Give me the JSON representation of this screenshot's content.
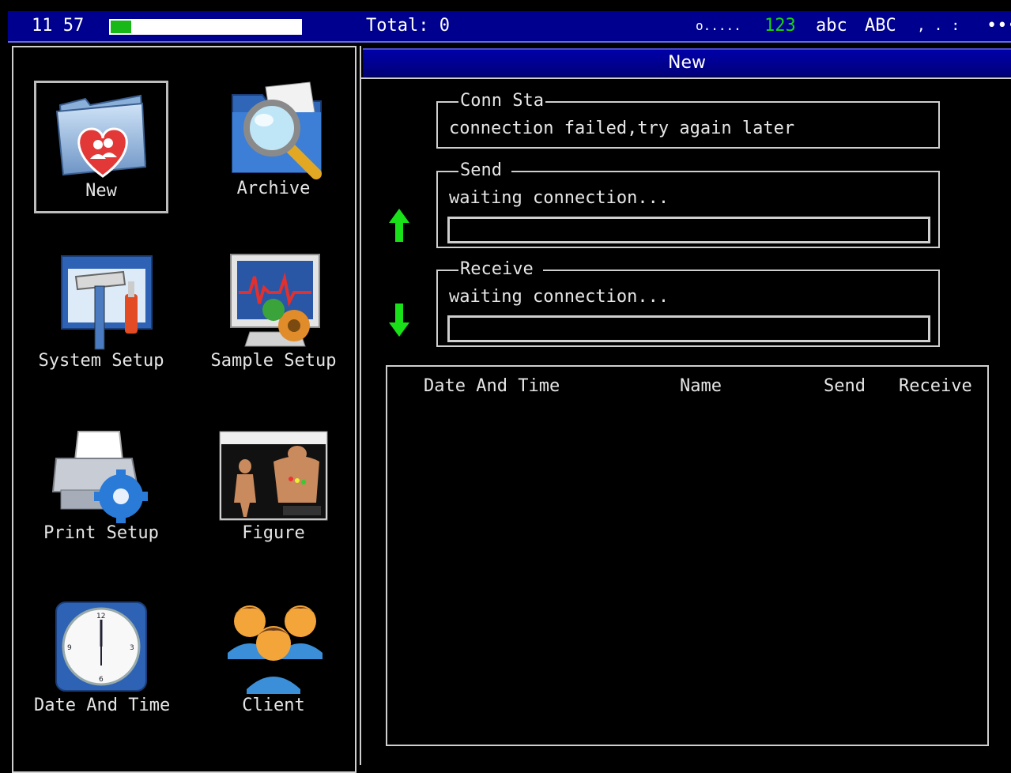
{
  "status_bar": {
    "time": "11 57",
    "battery_percent": 11,
    "total": "Total: 0",
    "dots": "o.....",
    "mode_123": "123",
    "mode_abc": "abc",
    "mode_ABC": "ABC",
    "mode_punct": ", . :",
    "more": "•••",
    "colors": {
      "active_mode": "#19d419",
      "bar_bg": "#00008f"
    }
  },
  "menu": {
    "items": [
      {
        "label": "New",
        "icon": "folder-heart-icon",
        "selected": true
      },
      {
        "label": "Archive",
        "icon": "folder-magnifier-icon",
        "selected": false
      },
      {
        "label": "System Setup",
        "icon": "hammer-screwdriver-icon",
        "selected": false
      },
      {
        "label": "Sample Setup",
        "icon": "monitor-gear-icon",
        "selected": false
      },
      {
        "label": "Print Setup",
        "icon": "printer-gear-icon",
        "selected": false
      },
      {
        "label": "Figure",
        "icon": "body-figure-icon",
        "selected": false
      },
      {
        "label": "Date And Time",
        "icon": "clock-icon",
        "selected": false
      },
      {
        "label": "Client",
        "icon": "people-icon",
        "selected": false
      }
    ]
  },
  "panel": {
    "title": "New",
    "conn": {
      "legend": "Conn Sta",
      "text": "connection failed,try again later"
    },
    "send": {
      "legend": "Send",
      "text": "waiting connection...",
      "progress": 0
    },
    "receive": {
      "legend": "Receive",
      "text": "waiting connection...",
      "progress": 0
    },
    "table": {
      "columns": [
        "Date And Time",
        "Name",
        "Send",
        "Receive"
      ],
      "rows": []
    }
  }
}
